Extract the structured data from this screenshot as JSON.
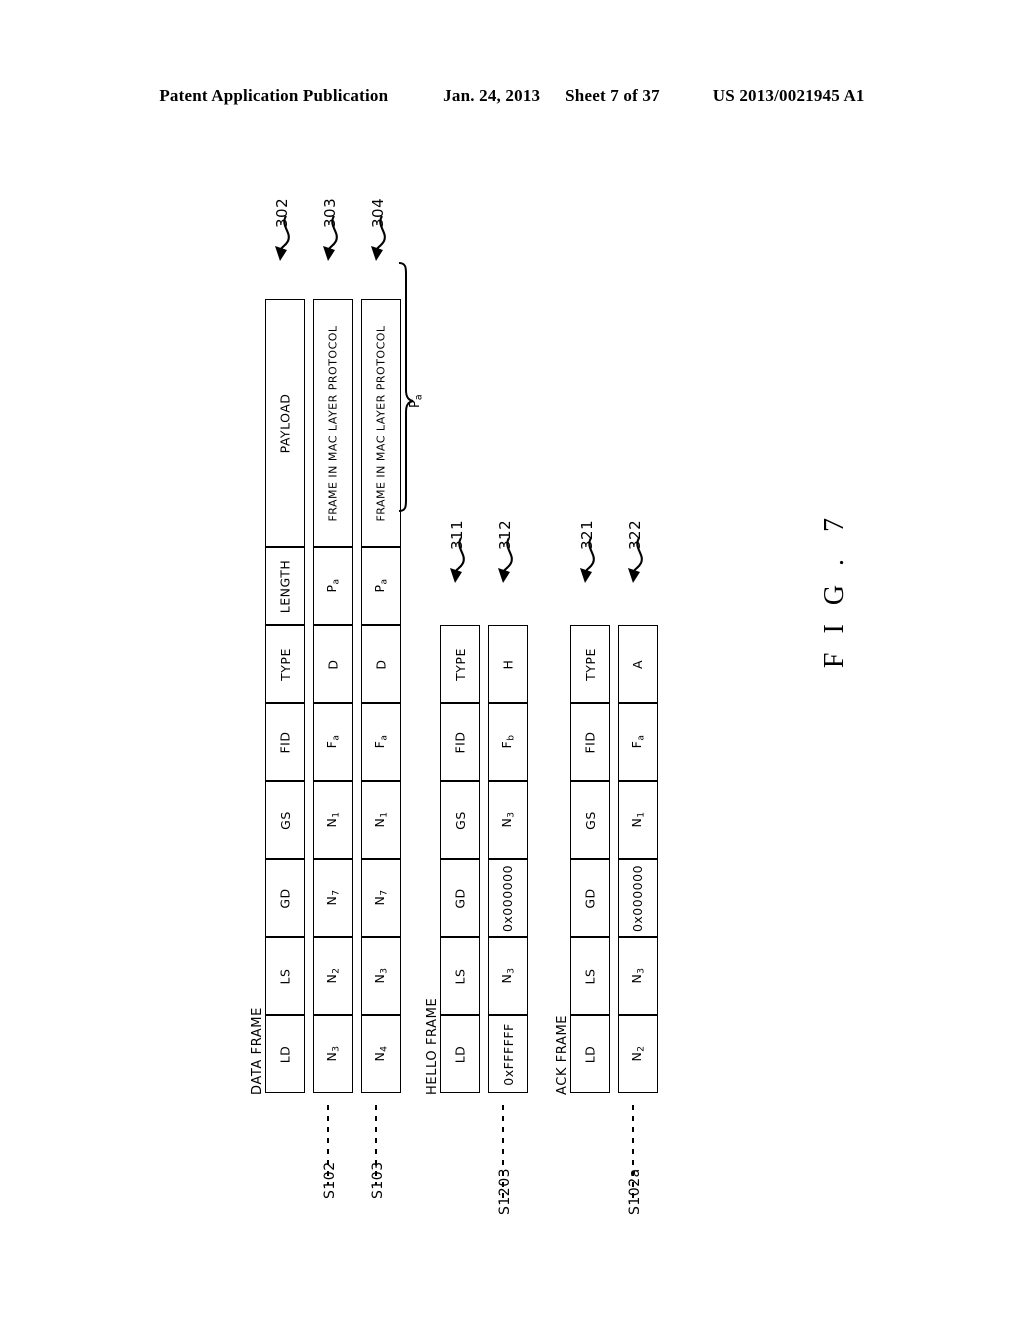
{
  "header": {
    "publication": "Patent Application Publication",
    "date": "Jan. 24, 2013",
    "sheet": "Sheet 7 of 37",
    "docnumber": "US 2013/0021945 A1"
  },
  "figure": {
    "label": "F I G .",
    "number": "7"
  },
  "frames": {
    "data": {
      "group_label": "DATA FRAME",
      "columns": [
        "LD",
        "LS",
        "GD",
        "GS",
        "FID",
        "TYPE",
        "LENGTH",
        "PAYLOAD"
      ],
      "rows": [
        {
          "step": "S102",
          "ref": "303",
          "cells": [
            "N3",
            "N2",
            "N7",
            "N1",
            "Fa",
            "D",
            "Pa",
            "FRAME IN MAC LAYER PROTOCOL"
          ]
        },
        {
          "step": "S103",
          "ref": "304",
          "cells": [
            "N4",
            "N3",
            "N7",
            "N1",
            "Fa",
            "D",
            "Pa",
            "FRAME IN MAC LAYER PROTOCOL"
          ]
        }
      ],
      "header_ref": "302",
      "brace_label": "Pa"
    },
    "hello": {
      "group_label": "HELLO FRAME",
      "columns": [
        "LD",
        "LS",
        "GD",
        "GS",
        "FID",
        "TYPE"
      ],
      "rows": [
        {
          "step": "S1203",
          "ref": "312",
          "cells": [
            "0xFFFFFF",
            "N3",
            "0x000000",
            "N3",
            "Fb",
            "H"
          ]
        }
      ],
      "header_ref": "311"
    },
    "ack": {
      "group_label": "ACK FRAME",
      "columns": [
        "LD",
        "LS",
        "GD",
        "GS",
        "FID",
        "TYPE"
      ],
      "rows": [
        {
          "step": "S102a",
          "ref": "322",
          "cells": [
            "N2",
            "N3",
            "0x000000",
            "N1",
            "Fa",
            "A"
          ]
        }
      ],
      "header_ref": "321"
    }
  },
  "subscripts": {
    "N1": "N₁",
    "N2": "N₂",
    "N3": "N₃",
    "N4": "N₄",
    "N7": "N₇",
    "Fa": "Fₐ",
    "Fb": "Fᵇ",
    "Pa": "Pₐ"
  },
  "colors": {
    "ink": "#000000",
    "paper": "#ffffff"
  }
}
